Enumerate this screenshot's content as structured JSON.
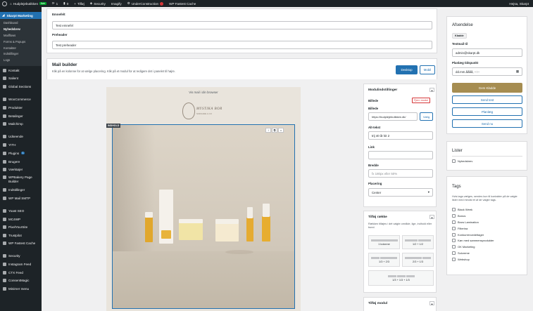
{
  "adminbar": {
    "site": "Hudplejebutikken",
    "live": "live",
    "updates": "1",
    "comments": "0",
    "new": "Tilføj",
    "security": "Security",
    "imagify": "Imagify",
    "under_construction": "UnderConstruction",
    "cache": "WP Fastest Cache",
    "greeting": "Hejsa, Skarpt"
  },
  "sidebar": {
    "active": "Skarpt Marketing",
    "sub": [
      "Dashboard",
      "Nyhedsbrev",
      "Mailflows",
      "Forms & Popups",
      "Kontakter",
      "Indstillinger",
      "Logs"
    ],
    "items_a": [
      "Kontakt",
      "Salient",
      "Global Sections"
    ],
    "items_b": [
      "WooCommerce",
      "Produkter",
      "Betalinger",
      "Mailchimp"
    ],
    "items_c": [
      "Udseende",
      "YITH",
      "Plugins",
      "Brugere",
      "Værktøjer",
      "WPBakery Page Builder",
      "Indstillinger",
      "WP Mail SMTP"
    ],
    "plugins_badge": "1",
    "items_d": [
      "Yoast SEO",
      "MC4WP",
      "PixelYourSite",
      "Trustpilot",
      "WP Fastest Cache"
    ],
    "items_e": [
      "Security",
      "Instagram Feed",
      "CTX Feed",
      "ConsentMagic",
      "Minimer menu"
    ]
  },
  "fields": {
    "subject_label": "Emnefelt",
    "subject_value": "Test emnefel",
    "preheader_label": "Preheader",
    "preheader_value": "Test preheader"
  },
  "builder": {
    "title": "Mail builder",
    "subtitle": "Klik på en kolonne for at vælge placering. Klik på et modul for at redigere det i panelet til højre.",
    "desktop": "Desktop",
    "mobile": "Mobil"
  },
  "email": {
    "top_link": "Vis mail i din browser",
    "brand": "MYSTIKA BOR",
    "brand_tag": "SKINCARE & CO",
    "section_tag": "INDHOLD",
    "tools": [
      "↑",
      "⧉",
      "×"
    ]
  },
  "modules": {
    "title": "Modulindstillinger",
    "image_label": "Billede",
    "remove": "Fjern modul",
    "image_field_label": "Billede",
    "image_url": "https://hudplejebutikken.dk/",
    "choose": "Vælg",
    "alt_label": "Alt-tekst",
    "alt_value": "trij 40 år kit 2",
    "link_label": "Link",
    "link_value": "",
    "width_label": "Bredde",
    "width_placeholder": "fx 180px eller 50%",
    "placement_label": "Placering",
    "placement_value": "Center"
  },
  "rows": {
    "title": "Tilføj række",
    "hint": "Rækken tilføjes i det valgte område, lige, indhold eller bund.",
    "layouts": [
      "1 kolonne",
      "1/2 + 1/2",
      "1/3 + 2/3",
      "2/3 + 1/3",
      "1/3 + 1/3 + 1/3"
    ]
  },
  "add_module": {
    "title": "Tilføj modul"
  },
  "sender": {
    "title": "Afsendelse",
    "status": "Kladde",
    "testmail_label": "Testmail til",
    "testmail_value": "admin@skarpt.dk",
    "schedule_label": "Planlæg tidspunkt",
    "schedule_placeholder": "dd.mm.åååå, --:--",
    "save": "Gem Kladde",
    "send_test": "Send test",
    "plan": "Planlæg",
    "send_now": "Send nu"
  },
  "lists": {
    "title": "Lister",
    "items": [
      "Nyhedsbrev"
    ]
  },
  "tags": {
    "title": "Tags",
    "hint": "Hvis tags vælges, sendes kun til kontakter på de valgte lister med mindst ét af de valgte tags.",
    "items": [
      "Black Week",
      "Bonus",
      "Brow Lamination",
      "Filterina",
      "Konkurrencedeltager",
      "Køn med sammensprodukter",
      "OK Marketing",
      "Solcreme",
      "Webshop"
    ]
  },
  "colors": {
    "accent": "#2271b1",
    "gold": "#a68d51",
    "admin_dark": "#1d2327"
  }
}
